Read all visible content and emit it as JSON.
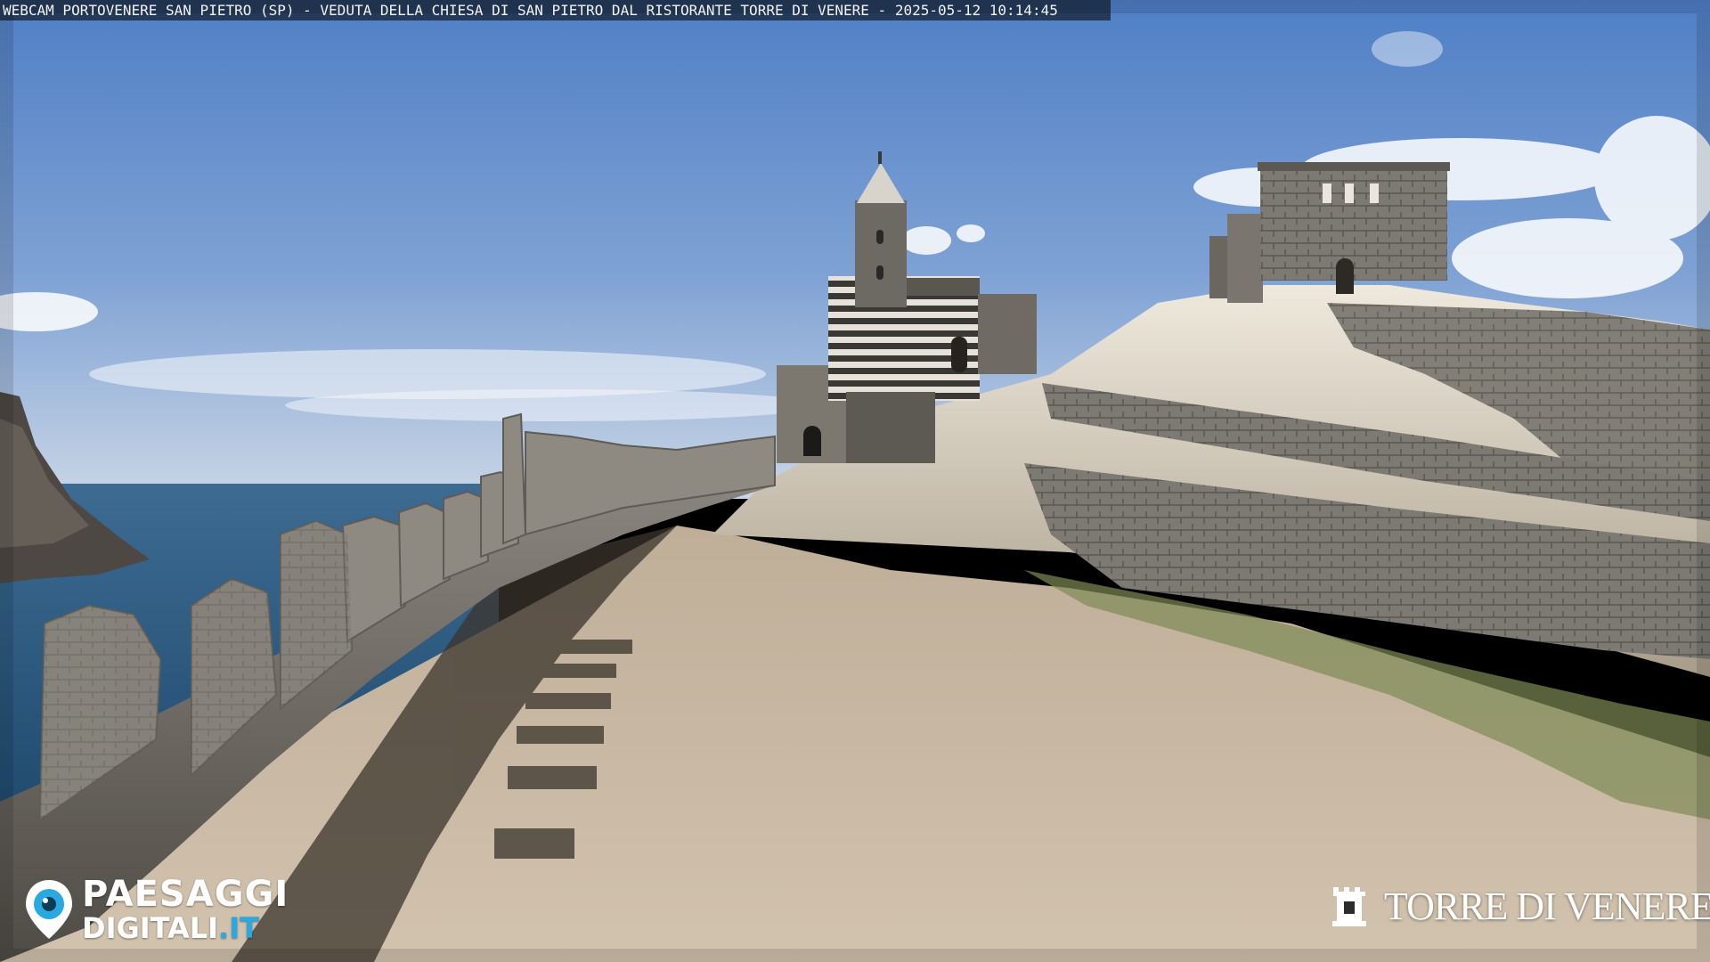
{
  "webcam": {
    "caption": "WEBCAM PORTOVENERE SAN PIETRO (SP) - VEDUTA DELLA CHIESA DI SAN PIETRO DAL RISTORANTE TORRE DI VENERE - 2025-05-12 10:14:45"
  },
  "watermarks": {
    "left_brand": {
      "line1": "PAESAGGI",
      "line2_main": "DIGITALI",
      "line2_tld": ".IT",
      "icon": "location-pin-eye-icon"
    },
    "right_brand": {
      "name": "TORRE DI VENERE",
      "icon": "castle-tower-icon"
    }
  },
  "colors": {
    "sky_top": "#5d86c8",
    "sky_horizon": "#c9d6e6",
    "sea": "#2f5d84",
    "path": "#cbb8a0",
    "stone": "#8d8a84",
    "rock_light": "#e8e3d8",
    "brand_accent": "#2aa9e0"
  }
}
